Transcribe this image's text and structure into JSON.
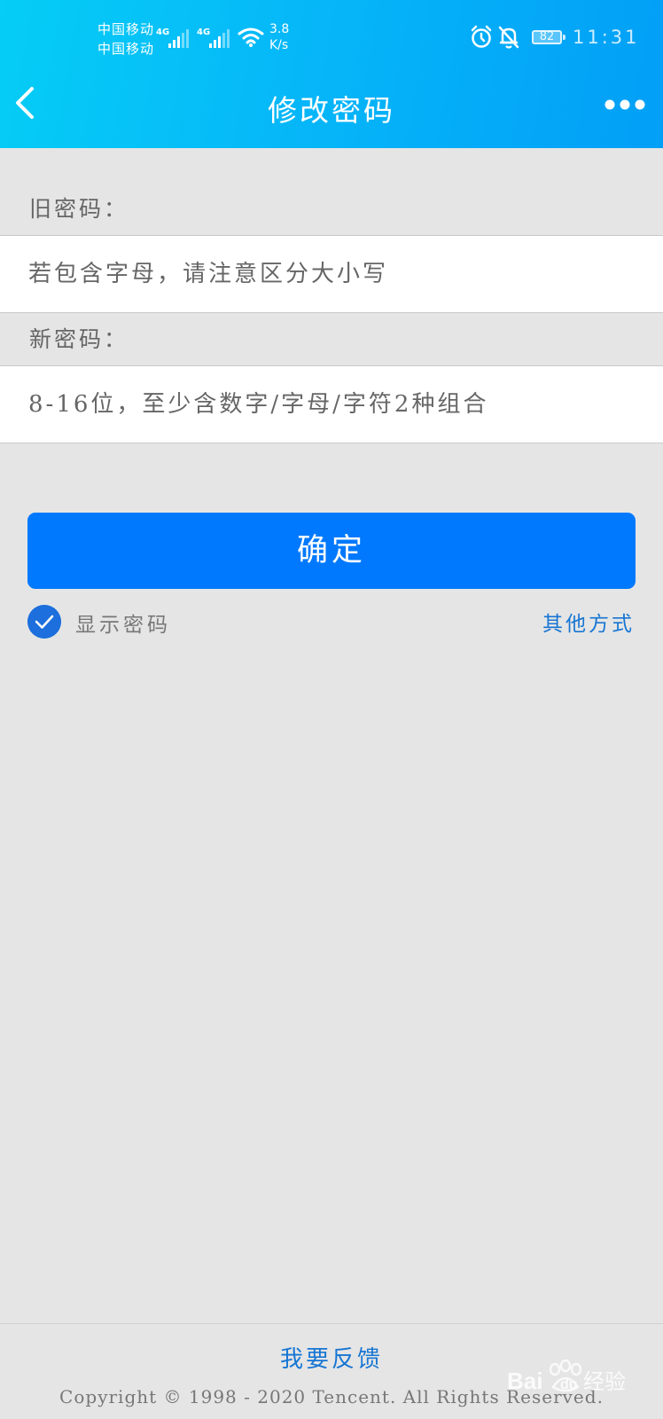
{
  "status_bar": {
    "carrier_1": "中国移动",
    "carrier_2": "中国移动",
    "network_1": "4G",
    "network_2": "4G",
    "speed_value": "3.8",
    "speed_unit": "K/s",
    "battery": "82",
    "time": "11:31",
    "icons": [
      "alarm-icon",
      "bell-off-icon",
      "wifi-icon",
      "signal-icon",
      "battery-icon"
    ]
  },
  "header": {
    "title": "修改密码",
    "back_icon": "chevron-left-icon",
    "more_icon": "more-dots-icon",
    "gradient_colors": [
      "#05cdf6",
      "#029ff7"
    ]
  },
  "form": {
    "old_password_label": "旧密码：",
    "old_password_placeholder": "若包含字母，请注意区分大小写",
    "new_password_label": "新密码：",
    "new_password_placeholder": "8-16位，至少含数字/字母/字符2种组合",
    "confirm_label": "确定",
    "show_password_label": "显示密码",
    "show_password_checked": true,
    "other_methods_label": "其他方式"
  },
  "footer": {
    "feedback_label": "我要反馈",
    "copyright": "Copyright © 1998 - 2020 Tencent. All Rights Reserved."
  },
  "watermark": {
    "text": "Baidu经验"
  },
  "colors": {
    "primary_button": "#0079fe",
    "link": "#1776d3",
    "background": "#e5e5e5"
  }
}
